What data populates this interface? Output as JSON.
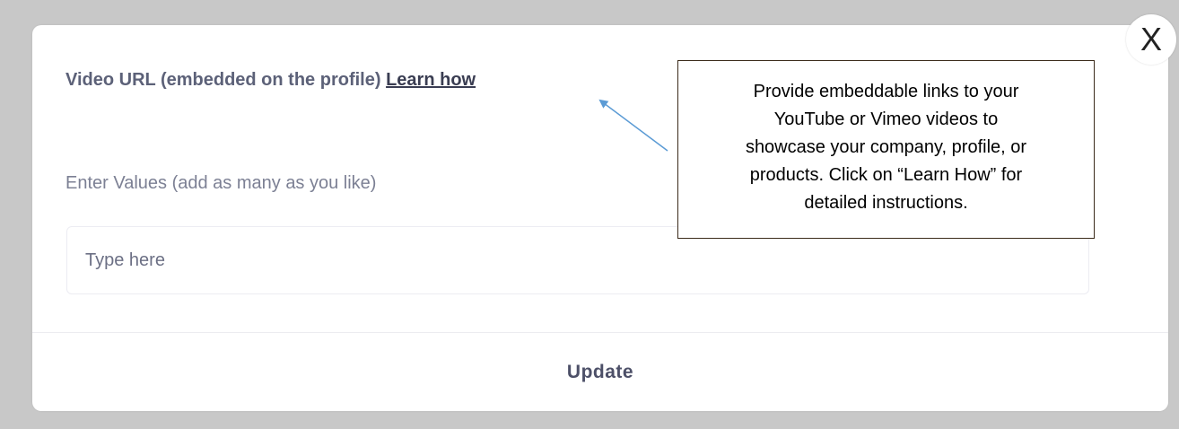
{
  "dialog": {
    "heading_text": "Video URL (embedded on the profile)",
    "learn_how_link": "Learn how",
    "values_label": "Enter Values (add as many as you like)",
    "input_placeholder": "Type here",
    "input_value": "",
    "update_label": "Update",
    "close_label": "X"
  },
  "callout": {
    "lines": [
      "Provide embeddable links to your",
      "YouTube or Vimeo videos to",
      "showcase your company, profile, or",
      "products.  Click on “Learn How” for",
      "detailed instructions."
    ]
  },
  "colors": {
    "backdrop": "#c8c8c8",
    "annotation_arrow": "#5b9bd5",
    "heading": "#5c6178",
    "label": "#7c8094"
  }
}
